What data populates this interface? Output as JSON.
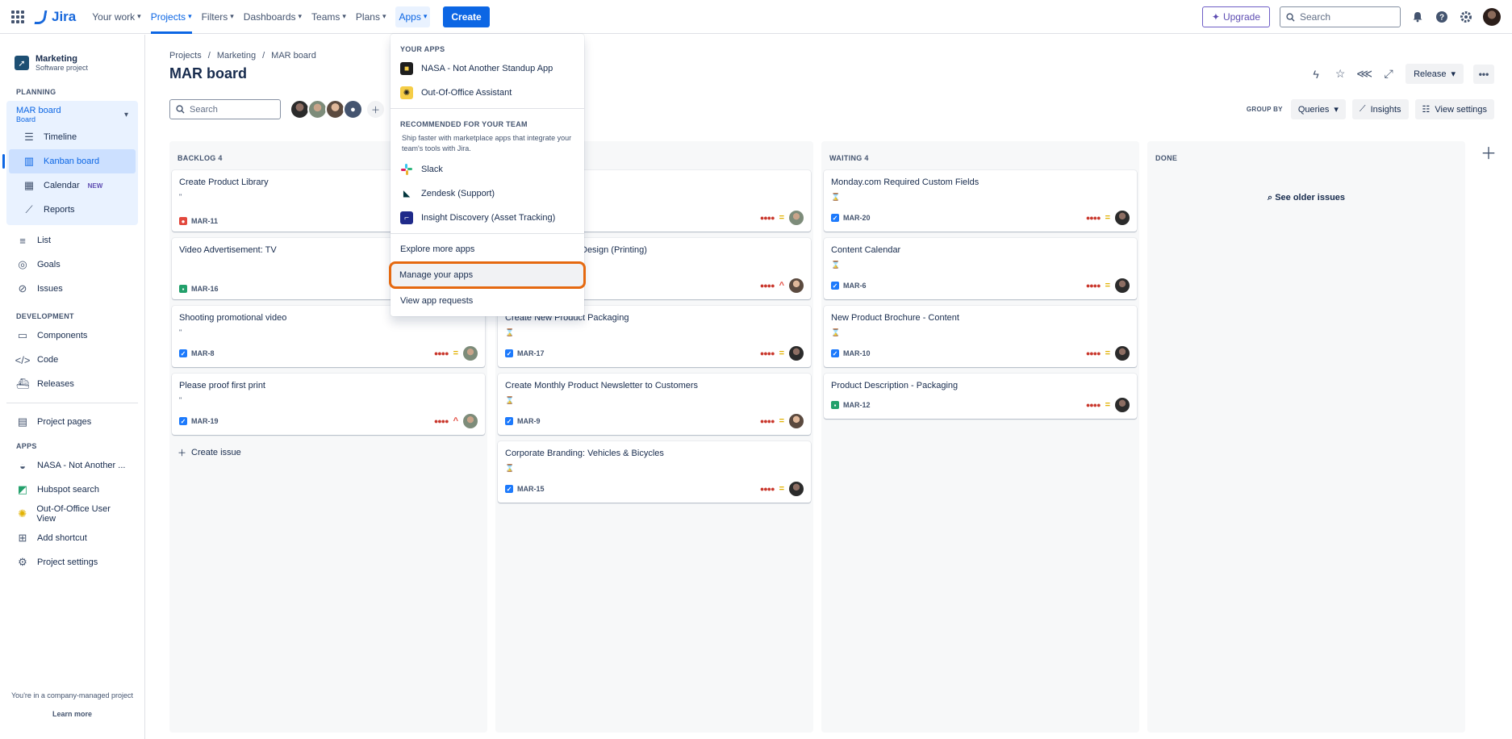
{
  "topnav": {
    "logo": "Jira",
    "items": [
      {
        "label": "Your work"
      },
      {
        "label": "Projects"
      },
      {
        "label": "Filters"
      },
      {
        "label": "Dashboards"
      },
      {
        "label": "Teams"
      },
      {
        "label": "Plans"
      },
      {
        "label": "Apps"
      }
    ],
    "create_label": "Create",
    "upgrade_label": "Upgrade",
    "search_placeholder": "Search"
  },
  "sidebar": {
    "project_name": "Marketing",
    "project_type": "Software project",
    "planning_title": "PLANNING",
    "board_name": "MAR board",
    "board_sub": "Board",
    "planning_items": [
      {
        "label": "Timeline",
        "icon": "timeline-icon"
      },
      {
        "label": "Kanban board",
        "icon": "board-icon"
      },
      {
        "label": "Calendar",
        "icon": "calendar-icon",
        "badge": "NEW"
      },
      {
        "label": "Reports",
        "icon": "reports-icon"
      }
    ],
    "general_items": [
      {
        "label": "List"
      },
      {
        "label": "Goals"
      },
      {
        "label": "Issues"
      }
    ],
    "development_title": "DEVELOPMENT",
    "development_items": [
      {
        "label": "Components"
      },
      {
        "label": "Code"
      },
      {
        "label": "Releases"
      }
    ],
    "project_pages": "Project pages",
    "apps_title": "APPS",
    "apps_items": [
      {
        "label": "NASA - Not Another ..."
      },
      {
        "label": "Hubspot search"
      },
      {
        "label": "Out-Of-Office User View"
      },
      {
        "label": "Add shortcut"
      },
      {
        "label": "Project settings"
      }
    ],
    "footer_text": "You're in a company-managed project",
    "footer_link": "Learn more"
  },
  "main": {
    "breadcrumbs": [
      "Projects",
      "Marketing",
      "MAR board"
    ],
    "title": "MAR board",
    "release_label": "Release",
    "search_placeholder": "Search",
    "group_by_label": "GROUP BY",
    "group_by_value": "Queries",
    "insights_label": "Insights",
    "view_settings_label": "View settings"
  },
  "columns": [
    {
      "title": "BACKLOG 4",
      "cards": [
        {
          "title": "Create Product Library",
          "key": "MAR-11",
          "type": "bug",
          "priority": "medium",
          "avatar": "dark"
        },
        {
          "title": "Video Advertisement: TV",
          "key": "MAR-16",
          "type": "story",
          "priority": "medium",
          "avatar": "dark"
        },
        {
          "title": "Shooting promotional video",
          "key": "MAR-8",
          "type": "task",
          "priority": "medium",
          "avatar": "light"
        },
        {
          "title": "Please proof first print",
          "key": "MAR-19",
          "type": "task",
          "priority": "high",
          "avatar": "light"
        }
      ],
      "create_issue": "Create issue"
    },
    {
      "title": "",
      "cards": [
        {
          "title": "",
          "key": "",
          "type": "task",
          "priority": "medium",
          "avatar": "light"
        },
        {
          "title": "Design (Printing)",
          "key": "",
          "type": "task",
          "priority": "high",
          "avatar": "warm"
        },
        {
          "title": "Create New Product Packaging",
          "key": "MAR-17",
          "type": "task",
          "priority": "medium",
          "avatar": "dark"
        },
        {
          "title": "Create Monthly Product Newsletter to Customers",
          "key": "MAR-9",
          "type": "task",
          "priority": "medium",
          "avatar": "warm"
        },
        {
          "title": "Corporate Branding: Vehicles & Bicycles",
          "key": "MAR-15",
          "type": "task",
          "priority": "medium",
          "avatar": "dark"
        }
      ]
    },
    {
      "title": "WAITING 4",
      "cards": [
        {
          "title": "Monday.com Required Custom Fields",
          "key": "MAR-20",
          "type": "task",
          "priority": "medium",
          "avatar": "dark"
        },
        {
          "title": "Content Calendar",
          "key": "MAR-6",
          "type": "task",
          "priority": "medium",
          "avatar": "dark"
        },
        {
          "title": "New Product Brochure - Content",
          "key": "MAR-10",
          "type": "task",
          "priority": "medium",
          "avatar": "dark"
        },
        {
          "title": "Product Description - Packaging",
          "key": "MAR-12",
          "type": "story",
          "priority": "medium",
          "avatar": "dark"
        }
      ]
    },
    {
      "title": "DONE",
      "cards": [],
      "see_older": "See older issues"
    }
  ],
  "apps_menu": {
    "your_apps_title": "YOUR APPS",
    "your_apps": [
      {
        "label": "NASA - Not Another Standup App",
        "icon": "nasa-app-icon"
      },
      {
        "label": "Out-Of-Office Assistant",
        "icon": "palm-tree-icon"
      }
    ],
    "recommended_title": "RECOMMENDED FOR YOUR TEAM",
    "recommended_desc": "Ship faster with marketplace apps that integrate your team's tools with Jira.",
    "recommended": [
      {
        "label": "Slack",
        "icon": "slack-icon"
      },
      {
        "label": "Zendesk (Support)",
        "icon": "zendesk-icon"
      },
      {
        "label": "Insight Discovery (Asset Tracking)",
        "icon": "insight-icon"
      }
    ],
    "explore": "Explore more apps",
    "manage": "Manage your apps",
    "requests": "View app requests"
  }
}
